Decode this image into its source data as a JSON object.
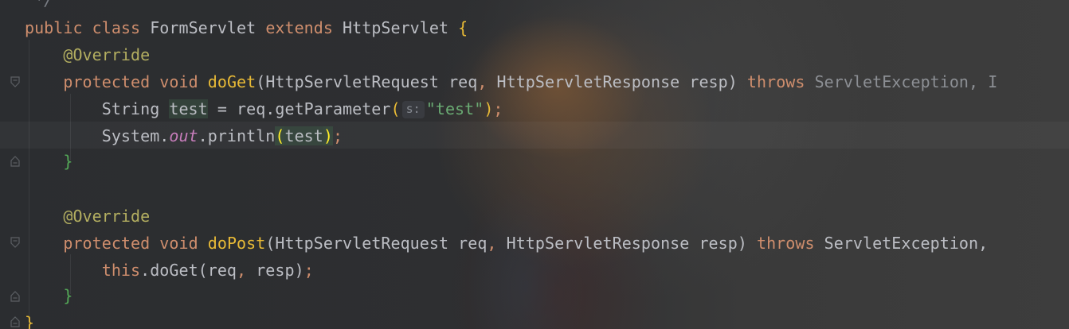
{
  "code": {
    "line0": {
      "comment": " */"
    },
    "line1": {
      "kw_public": "public",
      "kw_class": "class",
      "class_name": "FormServlet",
      "kw_extends": "extends",
      "super_class": "HttpServlet",
      "brace": "{"
    },
    "line2": {
      "annotation": "@Override"
    },
    "line3": {
      "kw_protected": "protected",
      "kw_void": "void",
      "method": "doGet",
      "paren_open": "(",
      "p1_type": "HttpServletRequest",
      "p1_name": "req",
      "comma": ",",
      "p2_type": "HttpServletResponse",
      "p2_name": "resp",
      "paren_close": ")",
      "kw_throws": "throws",
      "ex1": "ServletException,",
      "ex2": "I"
    },
    "line4": {
      "type": "String",
      "var": "test",
      "assign": "=",
      "call": "req.getParameter",
      "paren_open": "(",
      "hint": "s:",
      "arg": "\"test\"",
      "paren_close": ")",
      "semi": ";"
    },
    "line5": {
      "obj": "System.",
      "field": "out",
      "call": ".println",
      "paren_open": "(",
      "arg": "test",
      "paren_close": ")",
      "semi": ";"
    },
    "line6": {
      "brace": "}"
    },
    "line8": {
      "annotation": "@Override"
    },
    "line9": {
      "kw_protected": "protected",
      "kw_void": "void",
      "method": "doPost",
      "paren_open": "(",
      "p1_type": "HttpServletRequest",
      "p1_name": "req",
      "comma": ",",
      "p2_type": "HttpServletResponse",
      "p2_name": "resp",
      "paren_close": ")",
      "kw_throws": "throws",
      "ex1": "ServletException,"
    },
    "line10": {
      "kw_this": "this",
      "call": ".doGet",
      "paren_open": "(",
      "a1": "req",
      "comma": ",",
      "a2": "resp",
      "paren_close": ")",
      "semi": ";"
    },
    "line11": {
      "brace": "}"
    },
    "line12": {
      "brace": "}"
    }
  },
  "colors": {
    "keyword": "#cf8e6d",
    "annotation": "#b3ae60",
    "string": "#6aab73",
    "method_decl": "#e8ba36",
    "static_field": "#c77dbb",
    "default_text": "#bcbec4",
    "background": "#2b2d30"
  }
}
